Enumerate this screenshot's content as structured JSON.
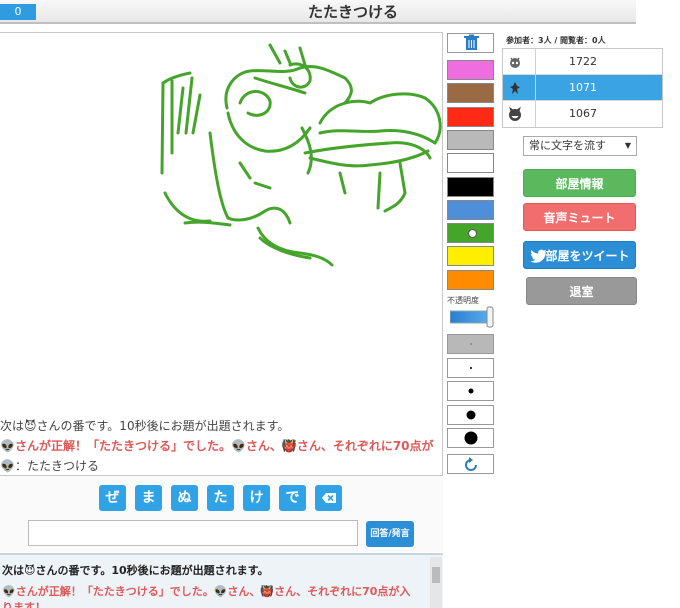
{
  "header": {
    "round": "0",
    "title": "たたきつける"
  },
  "canvas": {
    "messages": [
      "次は😈さんの番です。10秒後にお題が出題されます。",
      "👽さんが正解！「たたきつける」でした。👽さん、👹さん、それぞれに70点が",
      "👽：たたきつける"
    ]
  },
  "tools": {
    "trash_icon": "trash-icon",
    "colors": [
      "#ee6ee0",
      "#9a6a44",
      "#ff2a16",
      "#b9b9b9",
      "#ffffff",
      "#000000",
      "#4f8ed9",
      "#44a52a",
      "#ffee00",
      "#ff8c00"
    ],
    "selected_color": "#44a52a",
    "opacity_label": "不透明度",
    "opacity_level": 1.0,
    "brush_sizes": [
      1,
      2,
      5,
      9,
      13
    ],
    "selected_size": 0,
    "undo_icon": "undo-icon"
  },
  "sidebar": {
    "participants_info": "参加者：3人 / 閲覧者：0人",
    "players": [
      {
        "icon": "alien-icon",
        "score": "1722",
        "active": false
      },
      {
        "icon": "demon-icon",
        "score": "1071",
        "active": true
      },
      {
        "icon": "smiley-devil-icon",
        "score": "1067",
        "active": false
      }
    ],
    "flow_select": "常に文字を流す",
    "room_info_button": "部屋情報",
    "mute_button": "音声ミュート",
    "tweet_button": "部屋をツイート",
    "exit_button": "退室"
  },
  "answer": {
    "kana": [
      "ぜ",
      "ま",
      "ぬ",
      "た",
      "け",
      "で"
    ],
    "backspace_icon": "backspace-icon",
    "input_value": "",
    "send_button": "回答/発言"
  },
  "chat": {
    "lines": [
      "次は😈さんの番です。10秒後にお題が出題されます。",
      "👽さんが正解！「たたきつける」でした。👽さん、👹さん、それぞれに70点が入",
      "ります！"
    ]
  },
  "colors": {
    "accent": "#2fa3e6",
    "stroke": "#44a52a"
  }
}
